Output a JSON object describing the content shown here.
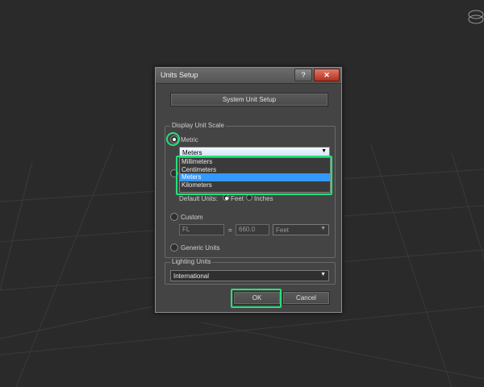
{
  "dialog": {
    "title": "Units Setup",
    "help_label": "?",
    "close_label": "✕",
    "system_unit_setup_label": "System Unit Setup"
  },
  "display_unit_scale": {
    "group_label": "Display Unit Scale",
    "metric_label": "Metric",
    "metric_selected": true,
    "metric_value": "Meters",
    "metric_options": [
      "Millimeters",
      "Centimeters",
      "Meters",
      "Kilometers"
    ],
    "metric_highlighted_option": "Meters",
    "default_units_label": "Default Units:",
    "feet_label": "Feet",
    "inches_label": "Inches",
    "custom_label": "Custom",
    "custom_name_value": "FL",
    "equals_label": "=",
    "custom_amount_value": "660.0",
    "custom_unit_value": "Feet",
    "generic_units_label": "Generic Units"
  },
  "lighting_units": {
    "group_label": "Lighting Units",
    "value": "International"
  },
  "footer": {
    "ok_label": "OK",
    "cancel_label": "Cancel"
  },
  "icons": {
    "dropdown_arrow": "▼",
    "highlight_color": "#26e07a",
    "selection_color": "#3399ff"
  }
}
